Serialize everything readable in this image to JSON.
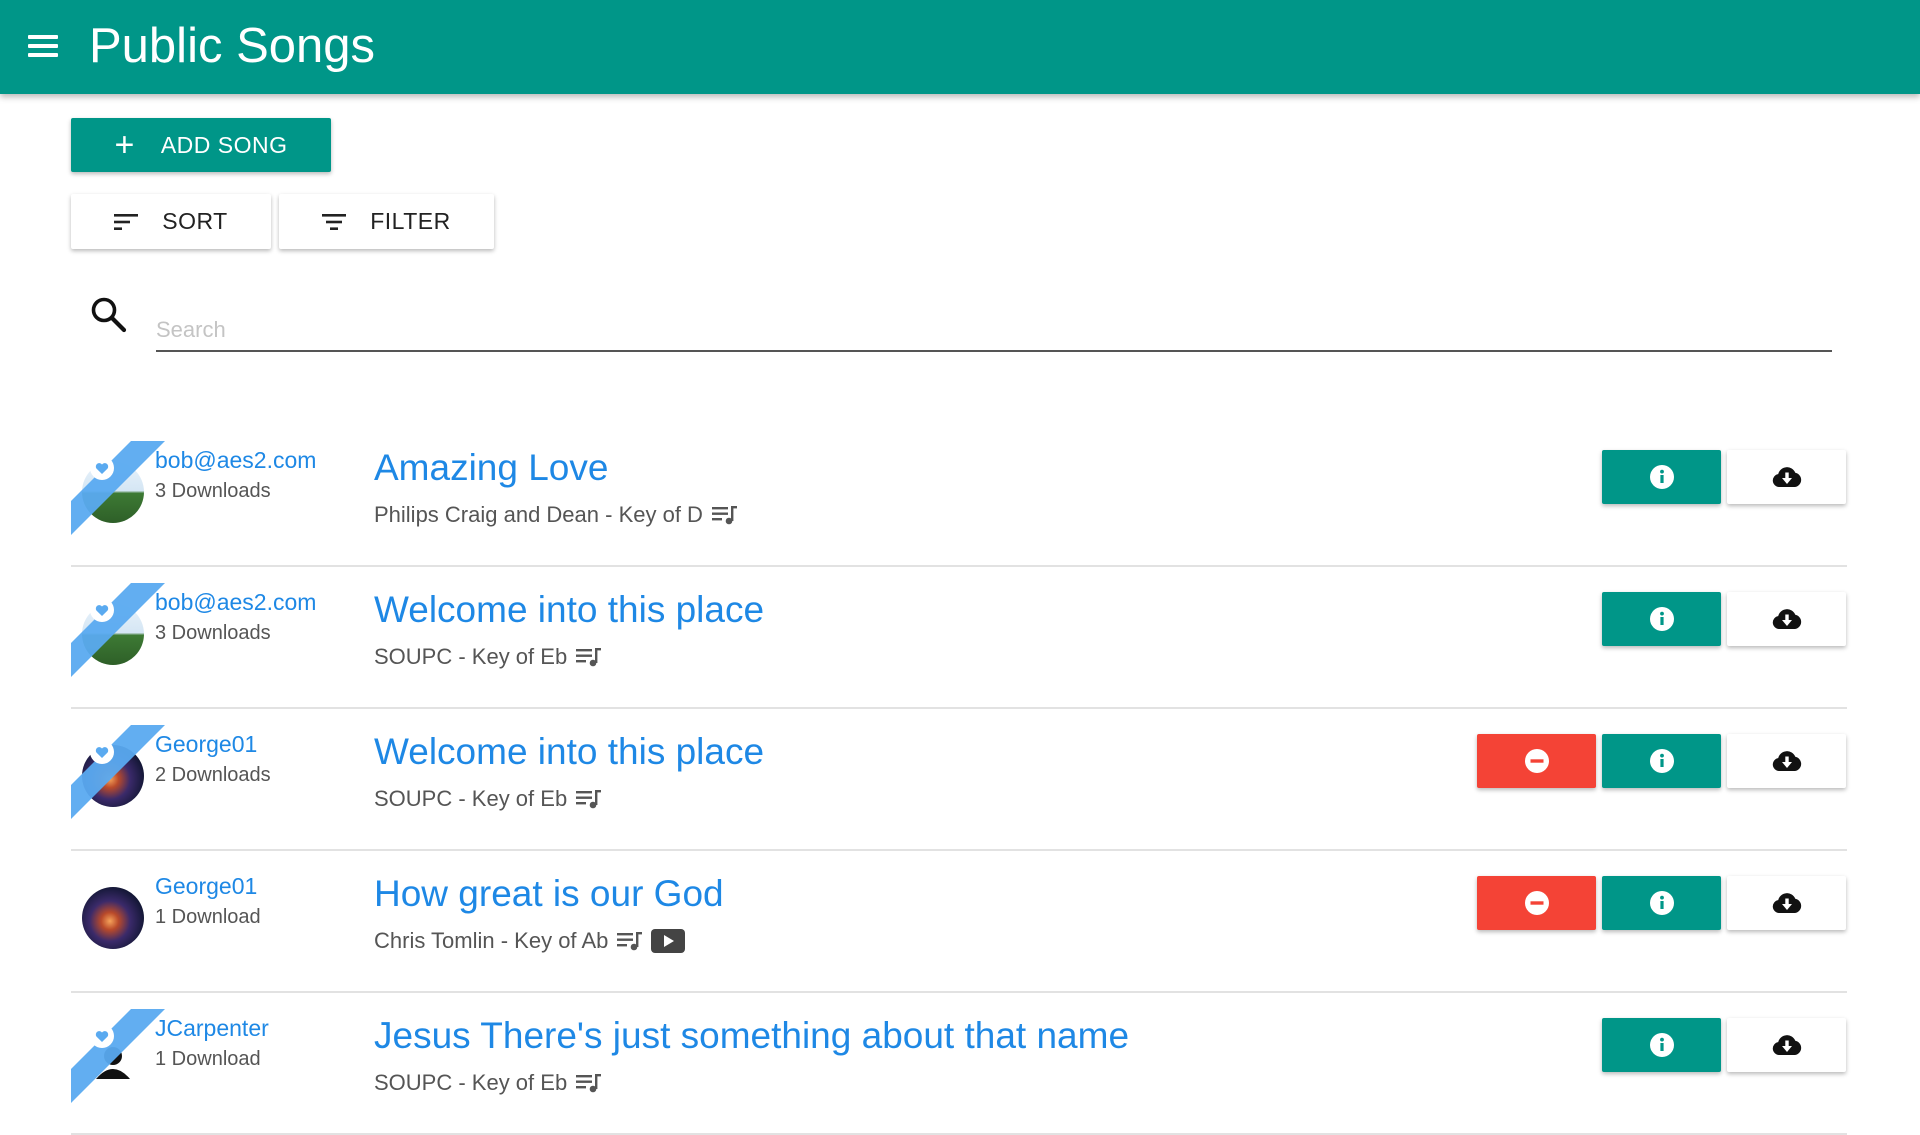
{
  "colors": {
    "primary": "#009688",
    "accent_blue": "#1e88e5",
    "remove_red": "#f44336",
    "ribbon_blue": "#5aaaf0"
  },
  "header": {
    "title": "Public Songs",
    "menu_icon": "menu-icon"
  },
  "toolbar": {
    "add_song_label": "ADD SONG",
    "add_icon": "plus-icon",
    "sort_label": "SORT",
    "sort_icon": "sort-icon",
    "filter_label": "FILTER",
    "filter_icon": "filter-icon"
  },
  "search": {
    "placeholder": "Search",
    "value": "",
    "icon": "search-icon"
  },
  "songs": [
    {
      "user": "bob@aes2.com",
      "downloads": "3 Downloads",
      "title": "Amazing Love",
      "subtitle": "Philips Craig and Dean - Key of D",
      "avatar": "landscape",
      "ribbon": true,
      "removable": false,
      "has_video": false
    },
    {
      "user": "bob@aes2.com",
      "downloads": "3 Downloads",
      "title": "Welcome into this place",
      "subtitle": "SOUPC - Key of Eb",
      "avatar": "landscape",
      "ribbon": true,
      "removable": false,
      "has_video": false
    },
    {
      "user": "George01",
      "downloads": "2 Downloads",
      "title": "Welcome into this place",
      "subtitle": "SOUPC - Key of Eb",
      "avatar": "galaxy",
      "ribbon": true,
      "removable": true,
      "has_video": false
    },
    {
      "user": "George01",
      "downloads": "1 Download",
      "title": "How great is our God",
      "subtitle": "Chris Tomlin - Key of Ab",
      "avatar": "galaxy",
      "ribbon": false,
      "removable": true,
      "has_video": true
    },
    {
      "user": "JCarpenter",
      "downloads": "1 Download",
      "title": "Jesus There's just something about that name",
      "subtitle": "SOUPC - Key of Eb",
      "avatar": "person",
      "ribbon": true,
      "removable": false,
      "has_video": false
    }
  ],
  "row_icons": {
    "lyrics": "lyrics-icon",
    "video": "play-video-icon",
    "remove": "remove-circle-icon",
    "info": "info-icon",
    "download": "cloud-download-icon",
    "favorite": "heart-icon"
  }
}
